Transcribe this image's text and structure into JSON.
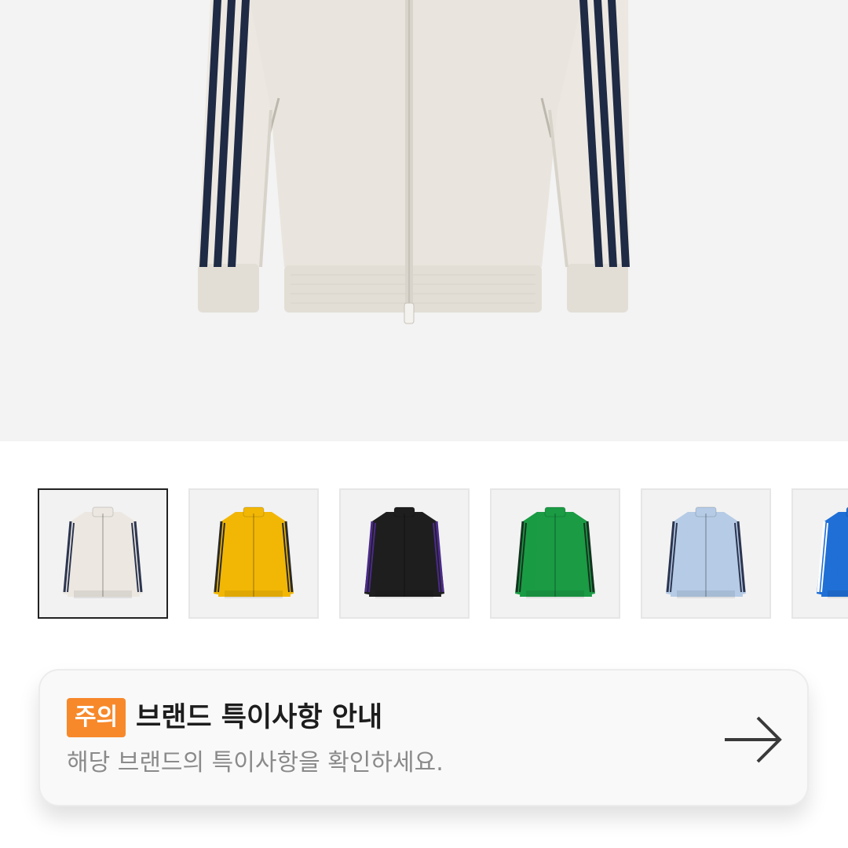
{
  "product": {
    "main_image": "jacket-front-image",
    "main_color": "#ece8e1",
    "stripe_color": "#1f2a44"
  },
  "thumbnails": [
    {
      "name": "white-navy",
      "body": "#ece8e1",
      "stripe": "#2c3550",
      "selected": true
    },
    {
      "name": "yellow",
      "body": "#f2b705",
      "stripe": "#2a2a2a",
      "selected": false
    },
    {
      "name": "black-purple",
      "body": "#1e1e1e",
      "stripe": "#4b2a8a",
      "selected": false
    },
    {
      "name": "green",
      "body": "#1a9b44",
      "stripe": "#14331f",
      "selected": false
    },
    {
      "name": "light-blue",
      "body": "#b5cbe6",
      "stripe": "#2c3550",
      "selected": false
    },
    {
      "name": "blue",
      "body": "#1f6fd6",
      "stripe": "#ffffff",
      "selected": false
    }
  ],
  "notice": {
    "badge": "주의",
    "badge_color": "#f7892b",
    "title": "브랜드 특이사항 안내",
    "description": "해당 브랜드의 특이사항을 확인하세요.",
    "arrow_icon": "arrow-right-icon"
  }
}
